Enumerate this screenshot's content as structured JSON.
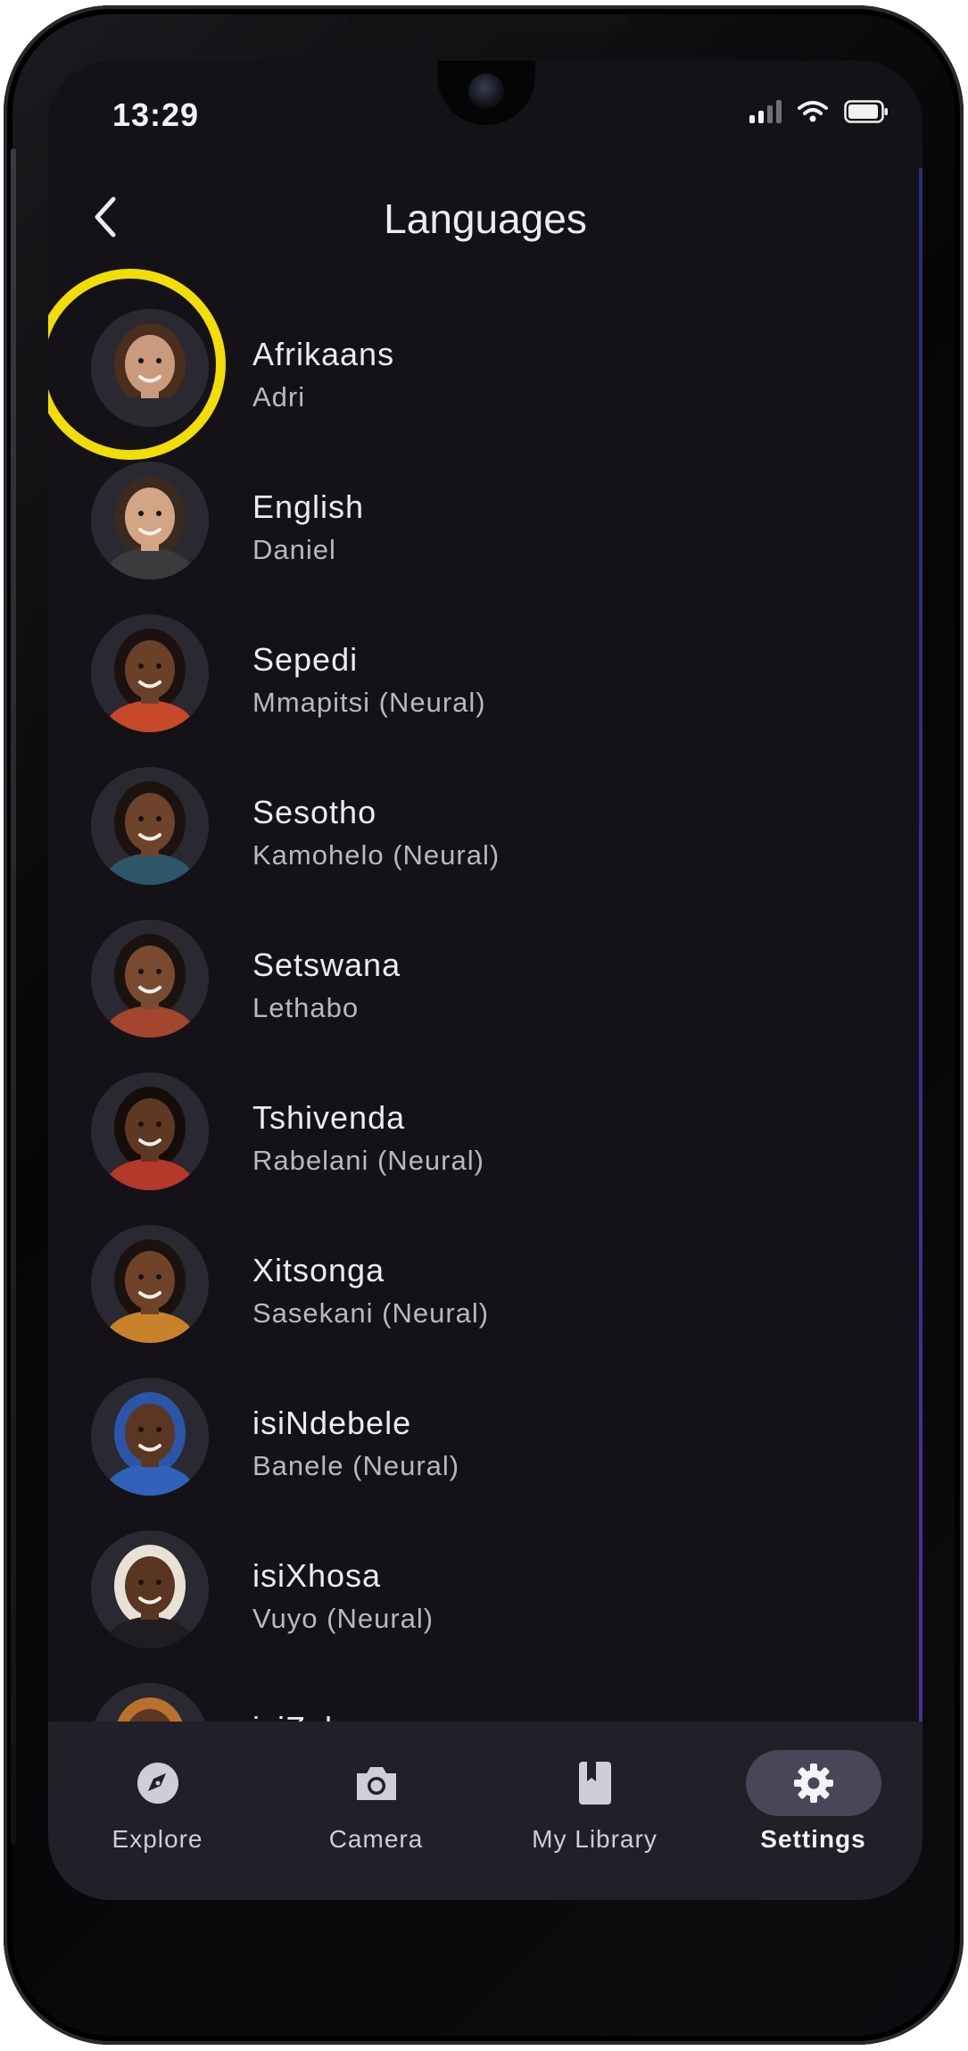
{
  "status_bar": {
    "time": "13:29"
  },
  "header": {
    "title": "Languages"
  },
  "languages": [
    {
      "language": "Afrikaans",
      "voice": "Adri",
      "selected": true,
      "skin": "#c99a7c",
      "hair": "#4a2e1e",
      "shirt": "#2c2a30"
    },
    {
      "language": "English",
      "voice": "Daniel",
      "selected": false,
      "skin": "#d2a584",
      "hair": "#3a2a1f",
      "shirt": "#3b3b3e"
    },
    {
      "language": "Sepedi",
      "voice": "Mmapitsi (Neural)",
      "selected": false,
      "skin": "#6a4028",
      "hair": "#1a1110",
      "shirt": "#c7492a"
    },
    {
      "language": "Sesotho",
      "voice": "Kamohelo (Neural)",
      "selected": false,
      "skin": "#6d432b",
      "hair": "#1c1210",
      "shirt": "#2f5568"
    },
    {
      "language": "Setswana",
      "voice": "Lethabo",
      "selected": false,
      "skin": "#7a4a30",
      "hair": "#1a120e",
      "shirt": "#a4452d"
    },
    {
      "language": "Tshivenda",
      "voice": "Rabelani (Neural)",
      "selected": false,
      "skin": "#5e3823",
      "hair": "#140d0a",
      "shirt": "#b5382a"
    },
    {
      "language": "Xitsonga",
      "voice": "Sasekani (Neural)",
      "selected": false,
      "skin": "#6f4329",
      "hair": "#1a120e",
      "shirt": "#c9822c"
    },
    {
      "language": "isiNdebele",
      "voice": "Banele (Neural)",
      "selected": false,
      "skin": "#5b3622",
      "hair": "#2a55a8",
      "shirt": "#2f62b8"
    },
    {
      "language": "isiXhosa",
      "voice": "Vuyo (Neural)",
      "selected": false,
      "skin": "#5a3622",
      "hair": "#e8e2d6",
      "shirt": "#1f1d22"
    },
    {
      "language": "isiZulu",
      "voice": "",
      "selected": false,
      "skin": "#5e3823",
      "hair": "#b9722c",
      "shirt": "#2a2830"
    }
  ],
  "bottom_nav": {
    "items": [
      {
        "label": "Explore",
        "icon": "compass-icon",
        "active": false
      },
      {
        "label": "Camera",
        "icon": "camera-icon",
        "active": false
      },
      {
        "label": "My Library",
        "icon": "book-icon",
        "active": false
      },
      {
        "label": "Settings",
        "icon": "gear-icon",
        "active": true
      }
    ]
  },
  "colors": {
    "background": "#141217",
    "highlight_ring": "#f2dd07",
    "nav_background": "#211f28",
    "nav_active_pill": "#4b4558"
  }
}
